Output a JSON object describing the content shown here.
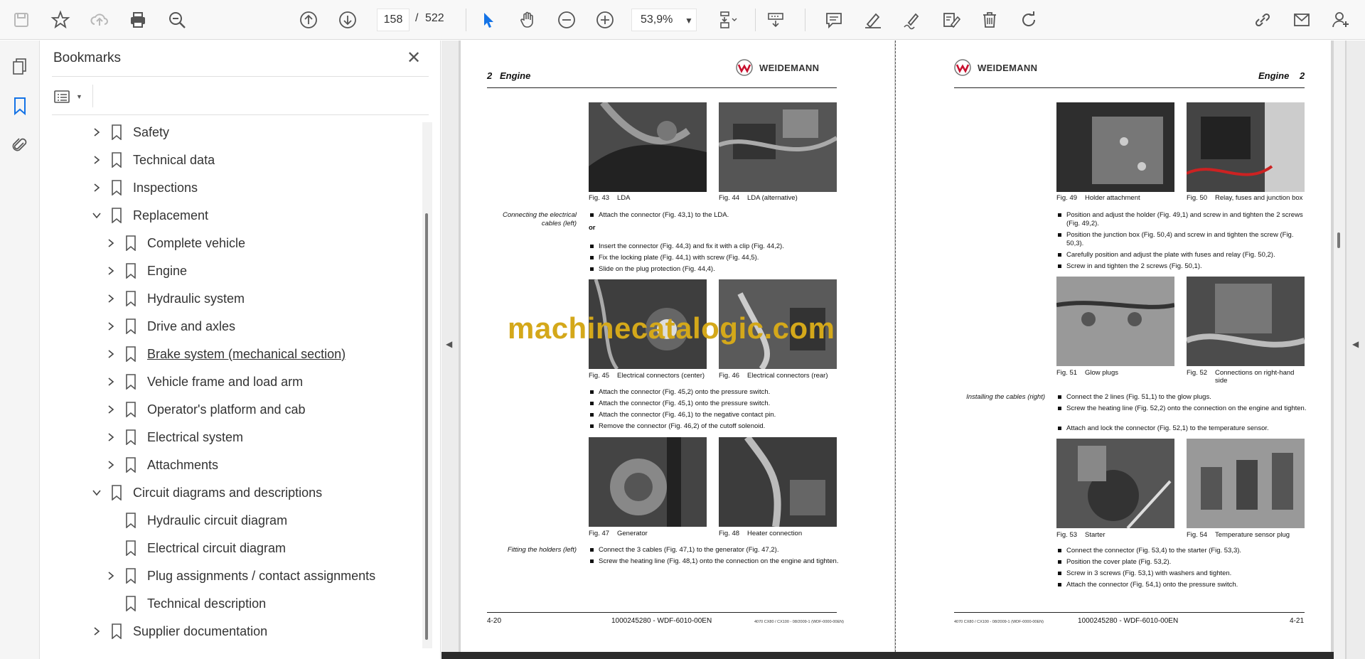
{
  "toolbar": {
    "page_current": "158",
    "page_separator": "/",
    "page_total": "522",
    "zoom": "53,9%"
  },
  "bookmarks": {
    "title": "Bookmarks",
    "items": [
      {
        "label": "Safety",
        "expand": "collapsed"
      },
      {
        "label": "Technical data",
        "expand": "collapsed"
      },
      {
        "label": "Inspections",
        "expand": "collapsed"
      },
      {
        "label": "Replacement",
        "expand": "expanded"
      },
      {
        "label": "Complete vehicle",
        "expand": "collapsed"
      },
      {
        "label": "Engine",
        "expand": "collapsed"
      },
      {
        "label": "Hydraulic system",
        "expand": "collapsed"
      },
      {
        "label": "Drive and axles",
        "expand": "collapsed"
      },
      {
        "label": "Brake system (mechanical section)",
        "expand": "collapsed"
      },
      {
        "label": "Vehicle frame and load arm",
        "expand": "collapsed"
      },
      {
        "label": "Operator's platform and cab",
        "expand": "collapsed"
      },
      {
        "label": "Electrical system",
        "expand": "collapsed"
      },
      {
        "label": "Attachments",
        "expand": "collapsed"
      },
      {
        "label": "Circuit diagrams and descriptions",
        "expand": "expanded"
      },
      {
        "label": "Hydraulic circuit diagram",
        "expand": "none"
      },
      {
        "label": "Electrical circuit diagram",
        "expand": "none"
      },
      {
        "label": "Plug assignments / contact assignments",
        "expand": "collapsed"
      },
      {
        "label": "Technical description",
        "expand": "none"
      },
      {
        "label": "Supplier documentation",
        "expand": "collapsed"
      }
    ]
  },
  "watermark": "machinecatalogic.com",
  "left_page": {
    "header_num": "2",
    "header_title": "Engine",
    "brand": "WEIDEMANN",
    "figures": [
      {
        "num": "Fig. 43",
        "name": "LDA"
      },
      {
        "num": "Fig. 44",
        "name": "LDA (alternative)"
      },
      {
        "num": "Fig. 45",
        "name": "Electrical connectors (center)"
      },
      {
        "num": "Fig. 46",
        "name": "Electrical connectors (rear)"
      },
      {
        "num": "Fig. 47",
        "name": "Generator"
      },
      {
        "num": "Fig. 48",
        "name": "Heater connection"
      }
    ],
    "section1_label": "Connecting the electrical cables (left)",
    "steps1": [
      "Attach the connector (Fig. 43,1) to the LDA."
    ],
    "or_word": "or",
    "steps2": [
      "Insert the connector (Fig. 44,3) and fix it with a clip (Fig. 44,2).",
      "Fix the locking plate (Fig. 44,1) with screw (Fig. 44,5).",
      "Slide on the plug protection (Fig. 44,4)."
    ],
    "steps3": [
      "Attach the connector (Fig. 45,2) onto the pressure switch.",
      "Attach the connector (Fig. 45,1) onto the pressure switch.",
      "Attach the connector (Fig. 46,1) to the negative contact pin.",
      "Remove the connector (Fig. 46,2) of the cutoff solenoid."
    ],
    "section2_label": "Fitting the holders (left)",
    "steps4": [
      "Connect the 3 cables (Fig. 47,1) to the generator (Fig. 47,2).",
      "Screw the heating line (Fig. 48,1) onto the connection on the engine and tighten."
    ],
    "footer_page": "4-20",
    "footer_doc": "1000245280 - WDF-6010-00EN",
    "footer_small": "4070 CX80 / CX100 - 08/2009-1 (WDF-0000-00EN)"
  },
  "right_page": {
    "header_num": "2",
    "header_title": "Engine",
    "brand": "WEIDEMANN",
    "figures": [
      {
        "num": "Fig. 49",
        "name": "Holder attachment"
      },
      {
        "num": "Fig. 50",
        "name": "Relay, fuses and junction box"
      },
      {
        "num": "Fig. 51",
        "name": "Glow plugs"
      },
      {
        "num": "Fig. 52",
        "name": "Connections on right-hand side"
      },
      {
        "num": "Fig. 53",
        "name": "Starter"
      },
      {
        "num": "Fig. 54",
        "name": "Temperature sensor plug"
      }
    ],
    "steps1": [
      "Position and adjust the holder (Fig. 49,1) and screw in and tighten the 2 screws (Fig. 49,2).",
      "Position the junction box (Fig. 50,4) and screw in and tighten the screw (Fig. 50,3).",
      "Carefully position and adjust the plate with fuses and relay (Fig. 50,2).",
      "Screw in and tighten the 2 screws (Fig. 50,1)."
    ],
    "section_label": "Installing the cables (right)",
    "steps2": [
      "Connect the 2 lines (Fig. 51,1) to the glow plugs.",
      "Screw the heating line (Fig. 52,2) onto the connection on the engine and tighten.",
      "Attach and lock the connector (Fig. 52,1) to the temperature sensor."
    ],
    "steps3": [
      "Connect the connector (Fig. 53,4) to the starter (Fig. 53,3).",
      "Position the cover plate (Fig. 53,2).",
      "Screw in 3 screws (Fig. 53,1) with washers and tighten.",
      "Attach the connector (Fig. 54,1) onto the pressure switch."
    ],
    "footer_page": "4-21",
    "footer_doc": "1000245280 - WDF-6010-00EN",
    "footer_small": "4070 CX80 / CX100 - 08/2009-1 (WDF-0000-00EN)"
  }
}
